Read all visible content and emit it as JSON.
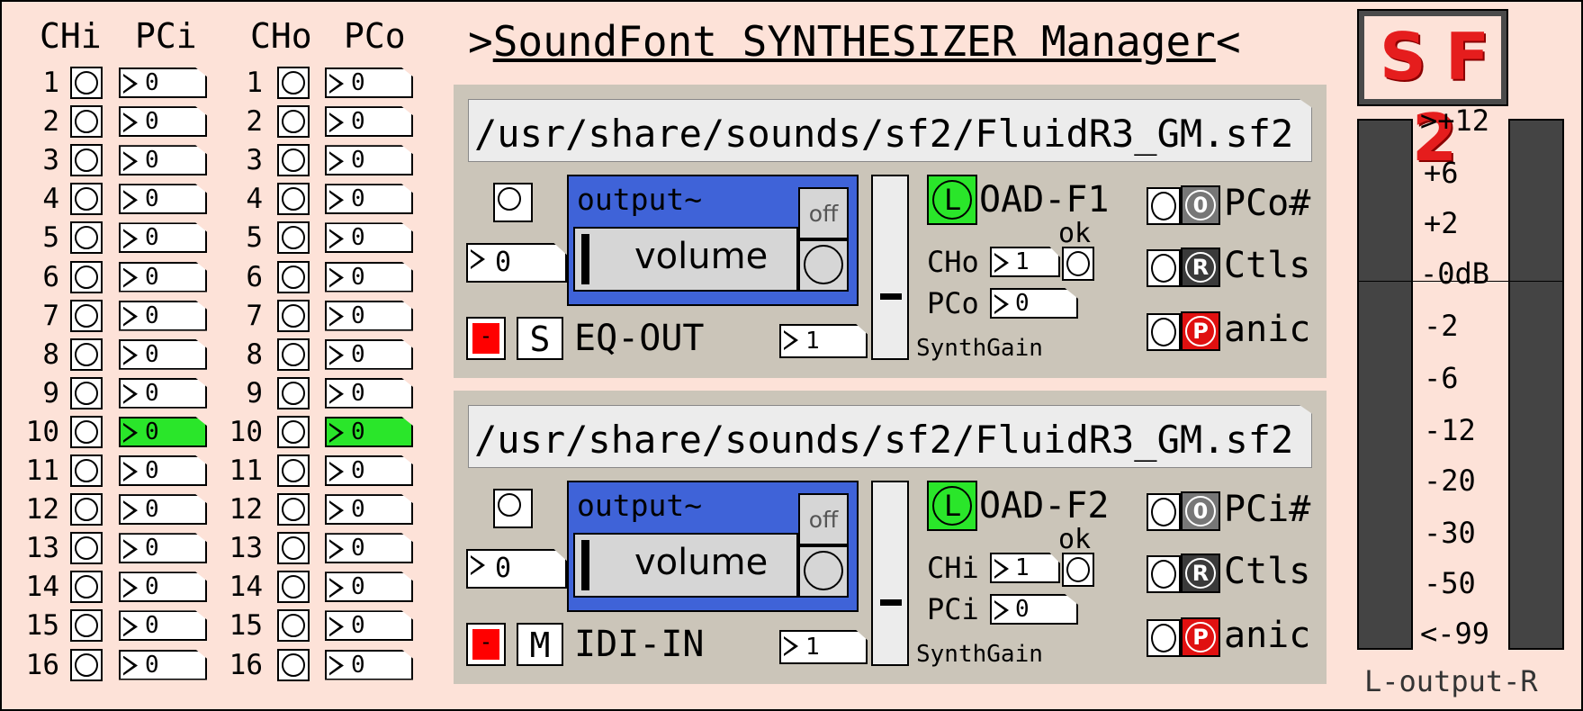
{
  "channels_in": {
    "ch_header": "CHi",
    "pc_header": "PCi",
    "rows": [
      {
        "num": "1",
        "value": "0"
      },
      {
        "num": "2",
        "value": "0"
      },
      {
        "num": "3",
        "value": "0"
      },
      {
        "num": "4",
        "value": "0"
      },
      {
        "num": "5",
        "value": "0"
      },
      {
        "num": "6",
        "value": "0"
      },
      {
        "num": "7",
        "value": "0"
      },
      {
        "num": "8",
        "value": "0"
      },
      {
        "num": "9",
        "value": "0"
      },
      {
        "num": "10",
        "value": "0"
      },
      {
        "num": "11",
        "value": "0"
      },
      {
        "num": "12",
        "value": "0"
      },
      {
        "num": "13",
        "value": "0"
      },
      {
        "num": "14",
        "value": "0"
      },
      {
        "num": "15",
        "value": "0"
      },
      {
        "num": "16",
        "value": "0"
      }
    ]
  },
  "channels_out": {
    "ch_header": "CHo",
    "pc_header": "PCo",
    "rows": [
      {
        "num": "1",
        "value": "0"
      },
      {
        "num": "2",
        "value": "0"
      },
      {
        "num": "3",
        "value": "0"
      },
      {
        "num": "4",
        "value": "0"
      },
      {
        "num": "5",
        "value": "0"
      },
      {
        "num": "6",
        "value": "0"
      },
      {
        "num": "7",
        "value": "0"
      },
      {
        "num": "8",
        "value": "0"
      },
      {
        "num": "9",
        "value": "0"
      },
      {
        "num": "10",
        "value": "0"
      },
      {
        "num": "11",
        "value": "0"
      },
      {
        "num": "12",
        "value": "0"
      },
      {
        "num": "13",
        "value": "0"
      },
      {
        "num": "14",
        "value": "0"
      },
      {
        "num": "15",
        "value": "0"
      },
      {
        "num": "16",
        "value": "0"
      }
    ]
  },
  "highlighted_channel": "10",
  "highlight_color": "#2ae62a",
  "title": {
    "prefix": ">",
    "text": "SoundFont SYNTHESIZER Manager",
    "suffix": "<"
  },
  "logo": "S F 2",
  "synths": [
    {
      "path": "/usr/share/sounds/sf2/FluidR3_GM.sf2",
      "number": "0",
      "output_label": "output~",
      "volume_label": "volume",
      "off_label": "off",
      "mode_letter": "S",
      "mode_label": "EQ-OUT",
      "gain_number": "1",
      "gain_label": "SynthGain",
      "load_letter": "L",
      "load_label": "OAD-F1",
      "ch_label": "CHo",
      "ch_value": "1",
      "pc_label": "PCo",
      "pc_value": "0",
      "ok_label": "ok",
      "btn1_letter": "0",
      "btn1_label": "PCo#",
      "btn2_letter": "R",
      "btn2_label": "Ctls",
      "btn3_letter": "P",
      "btn3_label": "anic"
    },
    {
      "path": "/usr/share/sounds/sf2/FluidR3_GM.sf2",
      "number": "0",
      "output_label": "output~",
      "volume_label": "volume",
      "off_label": "off",
      "mode_letter": "M",
      "mode_label": "IDI-IN",
      "gain_number": "1",
      "gain_label": "SynthGain",
      "load_letter": "L",
      "load_label": "OAD-F2",
      "ch_label": "CHi",
      "ch_value": "1",
      "pc_label": "PCi",
      "pc_value": "0",
      "ok_label": "ok",
      "btn1_letter": "0",
      "btn1_label": "PCi#",
      "btn2_letter": "R",
      "btn2_label": "Ctls",
      "btn3_letter": "P",
      "btn3_label": "anic"
    }
  ],
  "button_colors": {
    "pc": "#777777",
    "ctls": "#3a3a3a",
    "panic": "#e01010"
  },
  "meter": {
    "ticks": [
      ">+12",
      "+6",
      "+2",
      "-0dB",
      "-2",
      "-6",
      "-12",
      "-20",
      "-30",
      "-50",
      "<-99"
    ],
    "label": "L-output-R"
  }
}
